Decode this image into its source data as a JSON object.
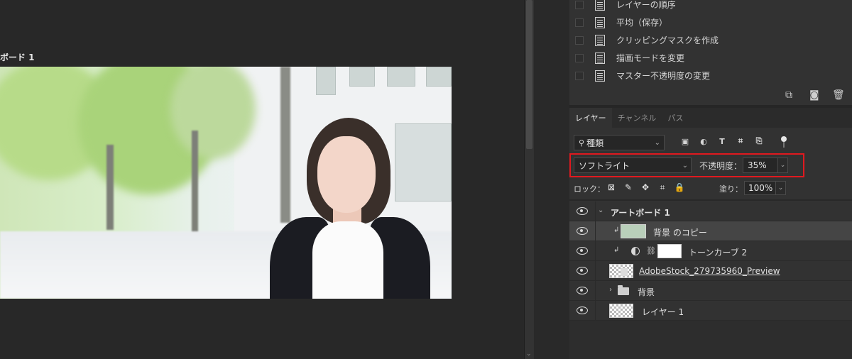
{
  "canvas": {
    "artboard_label": "ボード 1"
  },
  "history": {
    "items": [
      {
        "label": "レイヤーの順序"
      },
      {
        "label": "平均（保存）"
      },
      {
        "label": "クリッピングマスクを作成"
      },
      {
        "label": "描画モードを変更"
      },
      {
        "label": "マスター不透明度の変更"
      }
    ],
    "icons": [
      "new-snapshot-icon",
      "camera-icon",
      "trash-icon"
    ]
  },
  "tabs": [
    {
      "label": "レイヤー",
      "active": true
    },
    {
      "label": "チャンネル",
      "active": false
    },
    {
      "label": "パス",
      "active": false
    }
  ],
  "filter": {
    "kind_label": "種類",
    "icons": [
      "image-filter-icon",
      "adjustment-filter-icon",
      "type-filter-icon",
      "shape-filter-icon",
      "smart-object-filter-icon"
    ]
  },
  "blend": {
    "mode": "ソフトライト",
    "opacity_label": "不透明度：",
    "opacity_value": "35%"
  },
  "lock": {
    "label": "ロック：",
    "fill_label": "塗り：",
    "fill_value": "100%"
  },
  "layers": [
    {
      "name": "アートボード 1",
      "kind": "artboard"
    },
    {
      "name": "背景 のコピー",
      "kind": "clipped-pixel",
      "selected": true
    },
    {
      "name": "トーンカーブ 2",
      "kind": "adjustment"
    },
    {
      "name": "AdobeStock_279735960_Preview",
      "kind": "smart-object"
    },
    {
      "name": "背景",
      "kind": "group"
    },
    {
      "name": "レイヤー 1",
      "kind": "pixel"
    }
  ],
  "colors": {
    "panel_bg": "#323232",
    "canvas_bg": "#282828",
    "highlight": "#e0191f",
    "selected_row": "#454545"
  }
}
